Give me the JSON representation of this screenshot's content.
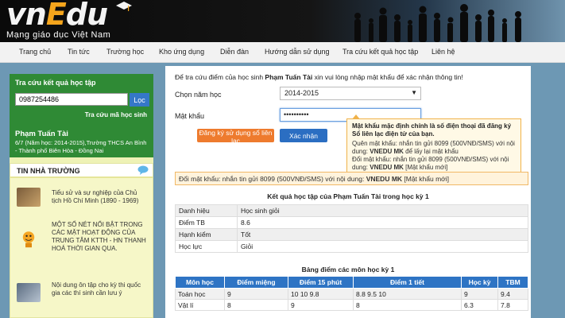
{
  "header": {
    "logo_a": "vn",
    "logo_b": "E",
    "logo_c": "du",
    "slogan": "Mạng giáo dục Việt Nam"
  },
  "nav": [
    "Trang chủ",
    "Tin tức",
    "Trường học",
    "Kho ứng dụng",
    "Diễn đàn",
    "Hướng dẫn sử dụng",
    "Tra cứu kết quả học tập",
    "Liên hệ"
  ],
  "lookup": {
    "title": "Tra cứu kết quả học tập",
    "phone_value": "0987254486",
    "button": "Lọc",
    "link": "Tra cứu mã học sinh",
    "student_name": "Phạm Tuấn Tài",
    "student_info": "6/7 (Năm học: 2014-2015),Trường THCS An Bình - Thành phố Biên Hòa - Đồng Nai"
  },
  "news": {
    "title": "TIN NHÀ TRƯỜNG",
    "items": [
      {
        "text": "Tiểu sử và sự nghiệp của Chủ tịch Hồ Chí Minh (1890 - 1969)"
      },
      {
        "text": "Một số nét nổi bật trong các mặt hoạt động của Trung tâm KTTH - HN Thanh Hoá thời gian qua."
      },
      {
        "text": "Nội dung ôn tập cho kỳ thi quốc gia các thí sinh cần lưu ý"
      }
    ]
  },
  "form": {
    "intro_a": "Để tra cứu điểm của học sinh ",
    "intro_name": "Phạm Tuấn Tài",
    "intro_b": " xin vui lòng nhập mật khẩu để xác nhận thông tin!",
    "year_label": "Chọn năm học",
    "year_value": "2014-2015",
    "year_arrow": "▼",
    "pw_label": "Mật khẩu",
    "pw_value": "••••••••••",
    "register_button": "Đăng ký sử dụng sổ liên lạc",
    "verify_button": "Xác nhận"
  },
  "tooltip": {
    "heading": "Mật khẩu mặc định chính là số điện thoại đã đăng ký Sổ liên lạc điện tử của bạn.",
    "line1a": "Quên mật khẩu: nhắn tin gửi 8099 (500VNĐ/SMS) với nội dung: ",
    "line1b": "VNEDU MK",
    "line1c": " để lấy lại mật khẩu",
    "line2a": "Đổi mật khẩu: nhắn tin gửi 8099 (500VNĐ/SMS) với nội dung: ",
    "line2b": "VNEDU MK",
    "line2c": " [Mật khẩu mới]"
  },
  "sms_bar": {
    "a": "Đổi mật khẩu: nhắn tin gửi 8099 (500VNĐ/SMS) với nội dung: ",
    "b": "VNEDU MK",
    "c": " [Mật khẩu mới]"
  },
  "result_title": "Kết quả học tập của Phạm Tuấn Tài trong học kỳ 1",
  "summary": [
    [
      "Danh hiệu",
      "Học sinh giỏi"
    ],
    [
      "Điểm TB",
      "8.6"
    ],
    [
      "Hạnh kiểm",
      "Tốt"
    ],
    [
      "Học lực",
      "Giỏi"
    ]
  ],
  "grades_title": "Bảng điểm các môn học kỳ 1",
  "grades_headers": [
    "Môn học",
    "Điểm miệng",
    "Điểm 15 phút",
    "Điểm 1 tiết",
    "Học kỳ",
    "TBM"
  ],
  "grades_rows": [
    [
      "Toán học",
      "9",
      "10  10  9.8",
      "8.8  9.5  10",
      "9",
      "9.4"
    ],
    [
      "Vật lí",
      "8",
      "9",
      "8",
      "6.3",
      "7.8"
    ]
  ],
  "colors": {
    "green": "#2f8a35",
    "orange": "#ee7b2e",
    "blue": "#2e74c4"
  }
}
